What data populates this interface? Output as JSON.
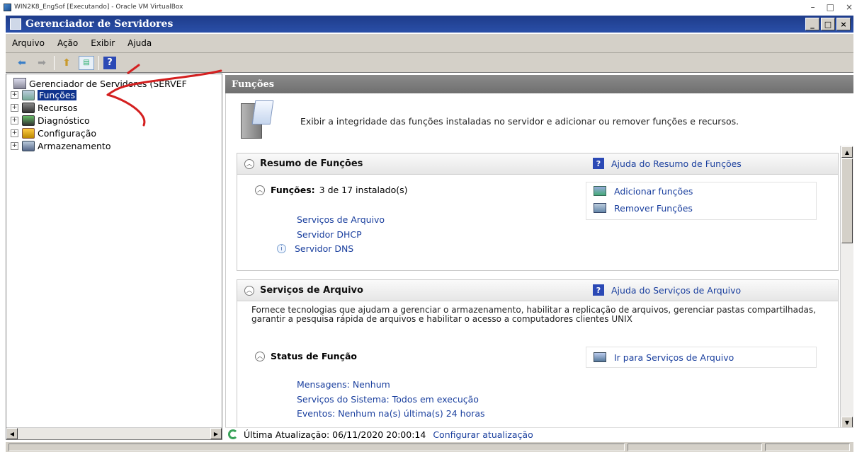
{
  "host": {
    "title": "WIN2K8_EngSof [Executando] - Oracle VM VirtualBox",
    "min": "–",
    "max": "□",
    "close": "×"
  },
  "window": {
    "title": "Gerenciador de Servidores",
    "min": "_",
    "max": "□",
    "close": "×"
  },
  "menu": [
    "Arquivo",
    "Ação",
    "Exibir",
    "Ajuda"
  ],
  "tree": {
    "root": "Gerenciador de Servidores (SERVEF",
    "items": [
      "Funções",
      "Recursos",
      "Diagnóstico",
      "Configuração",
      "Armazenamento"
    ]
  },
  "pane_header": "Funções",
  "intro_text": "Exibir a integridade das funções instaladas no servidor e adicionar ou remover funções e recursos.",
  "summary": {
    "title": "Resumo de Funções",
    "help": "Ajuda do Resumo de Funções",
    "roles_label": "Funções:",
    "roles_count": "3 de 17 instalado(s)",
    "installed": [
      "Serviços de Arquivo",
      "Servidor DHCP",
      "Servidor DNS"
    ],
    "add": "Adicionar funções",
    "remove": "Remover Funções"
  },
  "file_services": {
    "title": "Serviços de Arquivo",
    "help": "Ajuda do Serviços de Arquivo",
    "description": "Fornece tecnologias que ajudam a gerenciar o armazenamento, habilitar a replicação de arquivos, gerenciar pastas compartilhadas, garantir a pesquisa rápida de arquivos e habilitar o acesso a computadores clientes UNIX",
    "status_title": "Status de Função",
    "goto": "Ir para Serviços de Arquivo",
    "messages": "Mensagens: Nenhum",
    "system_services": "Serviços do Sistema: Todos em execução",
    "events": "Eventos: Nenhum na(s) última(s) 24 horas"
  },
  "footer": {
    "last_update": "Última Atualização: 06/11/2020 20:00:14",
    "configure": "Configurar atualização"
  }
}
